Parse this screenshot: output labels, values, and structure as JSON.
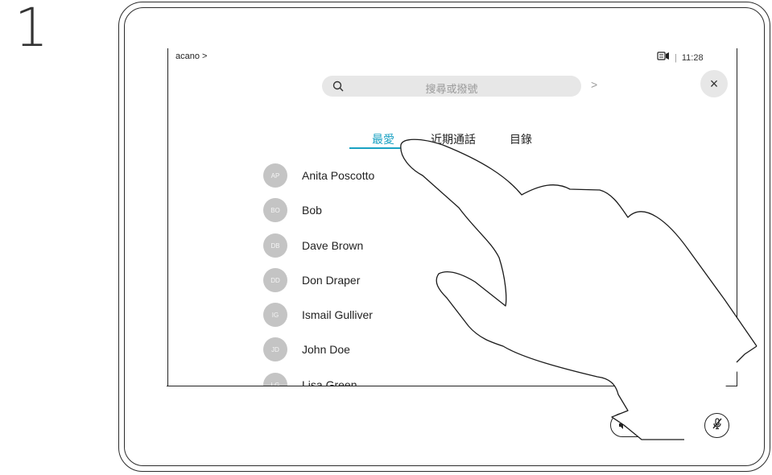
{
  "step": {
    "number": "1"
  },
  "header": {
    "breadcrumb": "acano >",
    "time": "11:28",
    "separator": "|"
  },
  "search": {
    "placeholder": "搜尋或撥號",
    "next": ">"
  },
  "close": {
    "label": "×"
  },
  "tabs": [
    {
      "label": "最愛",
      "active": true
    },
    {
      "label": "近期通話",
      "active": false
    },
    {
      "label": "目錄",
      "active": false
    }
  ],
  "contacts": [
    {
      "initials": "AP",
      "name": "Anita Poscotto"
    },
    {
      "initials": "BO",
      "name": "Bob"
    },
    {
      "initials": "DB",
      "name": "Dave Brown"
    },
    {
      "initials": "DD",
      "name": "Don Draper"
    },
    {
      "initials": "IG",
      "name": "Ismail Gulliver"
    },
    {
      "initials": "JD",
      "name": "John Doe"
    },
    {
      "initials": "LG",
      "name": "Lisa Green"
    }
  ],
  "controls": {
    "volume_down_icon": "volume-down-icon",
    "volume_up_icon": "volume-up-icon",
    "mute_icon": "microphone-muted-icon"
  },
  "colors": {
    "accent": "#1aa1c2",
    "avatar": "#c4c4c4",
    "search_bg": "#e7e7e7"
  }
}
